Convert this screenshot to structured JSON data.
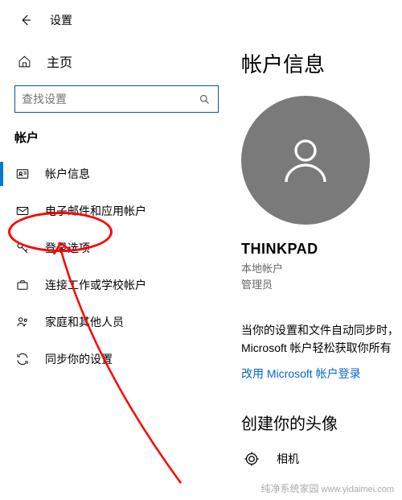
{
  "header": {
    "title": "设置"
  },
  "sidebar": {
    "home_label": "主页",
    "search_placeholder": "查找设置",
    "section_label": "帐户",
    "items": [
      {
        "label": "帐户信息"
      },
      {
        "label": "电子邮件和应用帐户"
      },
      {
        "label": "登录选项"
      },
      {
        "label": "连接工作或学校帐户"
      },
      {
        "label": "家庭和其他人员"
      },
      {
        "label": "同步你的设置"
      }
    ]
  },
  "main": {
    "title": "帐户信息",
    "username": "THINKPAD",
    "account_type": "本地帐户",
    "role": "管理员",
    "desc_line1": "当你的设置和文件自动同步时，",
    "desc_line2": "Microsoft 帐户轻松获取你所有",
    "link": "改用 Microsoft 帐户登录",
    "create_avatar_title": "创建你的头像",
    "camera_label": "相机"
  },
  "watermark": {
    "cn": "纯净系统家园",
    "url": "www.yidaimei.com"
  }
}
